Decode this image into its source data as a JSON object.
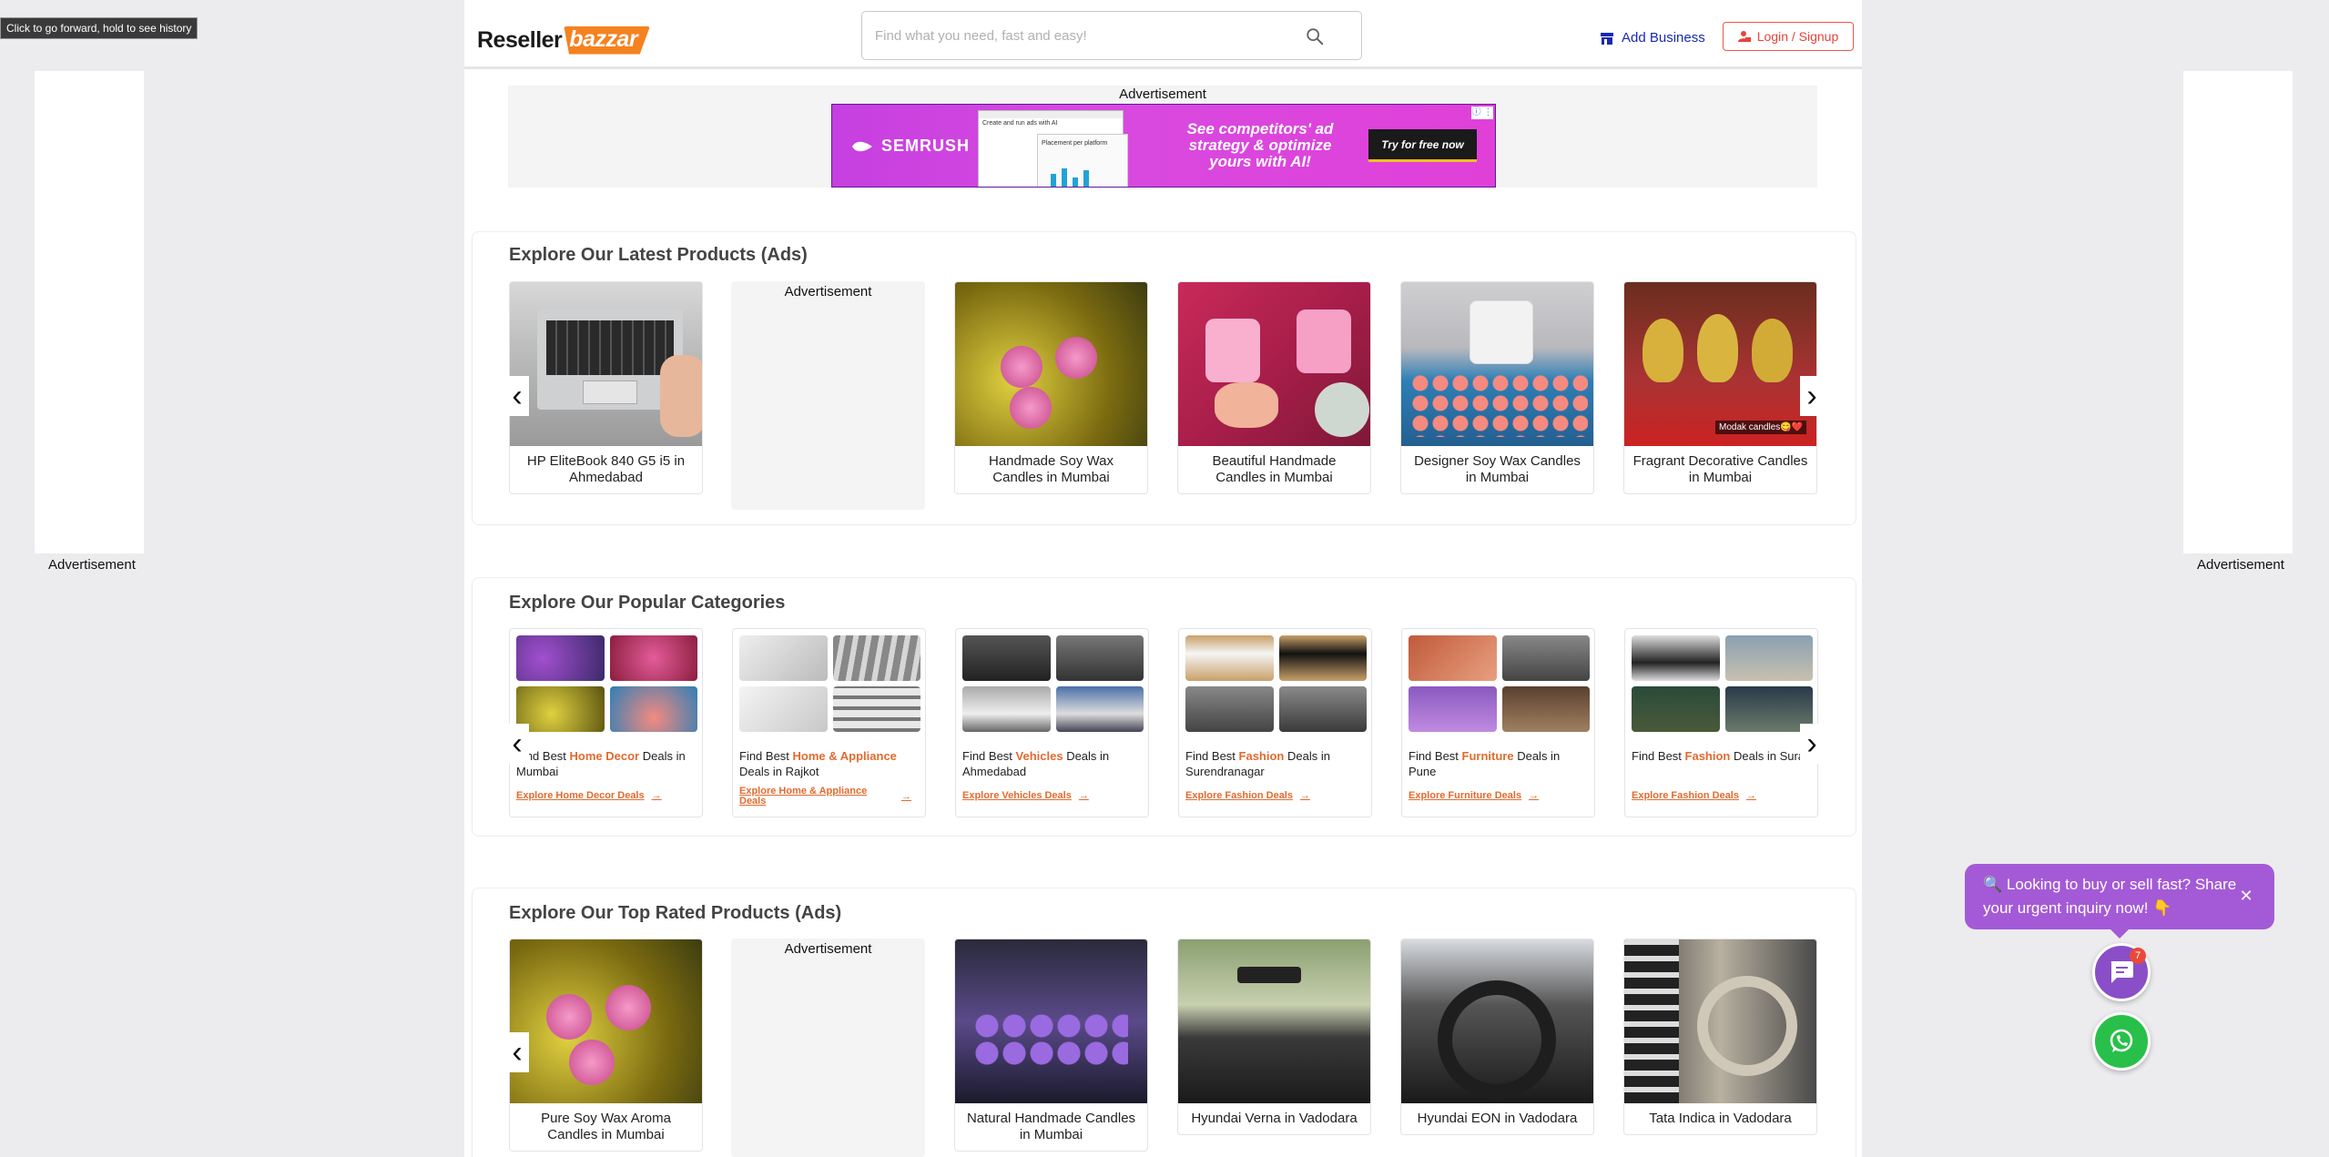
{
  "browser": {
    "tooltip": "Click to go forward, hold to see history"
  },
  "side_ads": {
    "left_label": "Advertisement",
    "right_label": "Advertisement"
  },
  "header": {
    "logo_part1": "Reseller",
    "logo_part2": "bazzar",
    "search_placeholder": "Find what you need, fast and easy!",
    "add_business": "Add Business",
    "login": "Login / Signup",
    "accent": "#f58220"
  },
  "top_ad": {
    "label": "Advertisement",
    "brand": "SEMRUSH",
    "copy": "See competitors' ad strategy & optimize yours with AI!",
    "cta": "Try for free now",
    "shot_title": "Create and run ads with AI",
    "shot_sub": "Placement per platform"
  },
  "latest": {
    "title": "Explore Our Latest Products (Ads)",
    "ad_label": "Advertisement",
    "items": [
      {
        "name": "HP EliteBook 840 G5 i5 in Ahmedabad"
      },
      {
        "name": "Handmade Soy Wax Candles in Mumbai"
      },
      {
        "name": "Beautiful Handmade Candles in Mumbai"
      },
      {
        "name": "Designer Soy Wax Candles in Mumbai"
      },
      {
        "name": "Fragrant Decorative Candles in Mumbai",
        "overlay": "Modak candles😋❤️"
      }
    ]
  },
  "categories": {
    "title": "Explore Our Popular Categories",
    "items": [
      {
        "pre": "Find Best ",
        "cat": "Home Decor",
        "post": " Deals in Mumbai",
        "link": "Explore Home Decor Deals"
      },
      {
        "pre": "Find Best ",
        "cat": "Home & Appliance",
        "post": " Deals in Rajkot",
        "link": "Explore Home & Appliance Deals"
      },
      {
        "pre": "Find Best ",
        "cat": "Vehicles",
        "post": " Deals in Ahmedabad",
        "link": "Explore Vehicles Deals"
      },
      {
        "pre": "Find Best ",
        "cat": "Fashion",
        "post": " Deals in Surendranagar",
        "link": "Explore Fashion Deals"
      },
      {
        "pre": "Find Best ",
        "cat": "Furniture",
        "post": " Deals in Pune",
        "link": "Explore Furniture Deals"
      },
      {
        "pre": "Find Best ",
        "cat": "Fashion",
        "post": " Deals in Surat",
        "link": "Explore Fashion Deals"
      }
    ]
  },
  "top_rated": {
    "title": "Explore Our Top Rated Products (Ads)",
    "ad_label": "Advertisement",
    "items": [
      {
        "name": "Pure Soy Wax Aroma Candles in Mumbai"
      },
      {
        "name": "Natural Handmade Candles in Mumbai"
      },
      {
        "name": "Hyundai Verna in Vadodara"
      },
      {
        "name": "Hyundai EON in Vadodara"
      },
      {
        "name": "Tata Indica in Vadodara"
      }
    ]
  },
  "chat": {
    "bubble": "🔍 Looking to buy or sell fast? Share your urgent inquiry now! 👇",
    "badge": "7"
  }
}
